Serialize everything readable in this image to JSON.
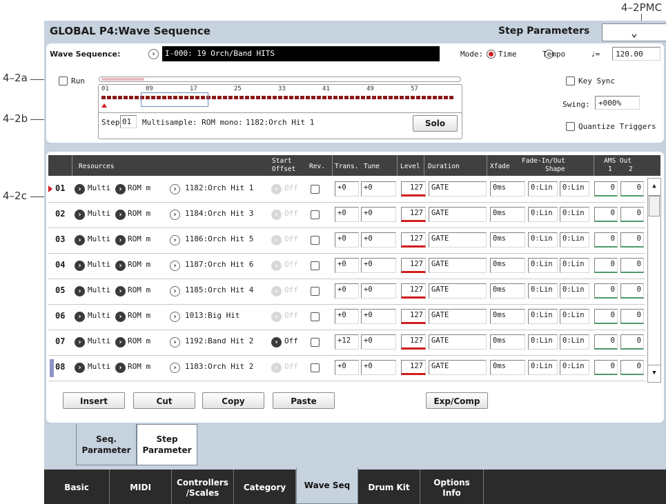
{
  "callouts": {
    "pmc": "4–2PMC",
    "a": "4–2a",
    "b": "4–2b",
    "c": "4–2c"
  },
  "page": {
    "title": "GLOBAL P4:Wave Sequence",
    "section": "Step Parameters",
    "menu_icon": "chevron-down-icon"
  },
  "wave_sequence": {
    "label": "Wave Sequence:",
    "value": "I-000: 19 Orch/Band HITS",
    "mode_label": "Mode:",
    "mode_options": [
      "Time",
      "Tempo"
    ],
    "mode_selected": "Time",
    "tempo_symbol": "♩=",
    "tempo_value": "120.00"
  },
  "overview": {
    "run_label": "Run",
    "ruler_ticks": [
      "01",
      "09",
      "17",
      "25",
      "33",
      "41",
      "49",
      "57"
    ],
    "step_label": "Step:",
    "step_value": "01",
    "multisample_label": "Multisample: ROM mono:",
    "multisample_value": "1182:Orch Hit 1",
    "solo_label": "Solo",
    "key_sync_label": "Key Sync",
    "swing_label": "Swing:",
    "swing_value": "+000%",
    "quantize_label": "Quantize Triggers",
    "step_count": 64
  },
  "table": {
    "headers": {
      "resources": "Resources",
      "start": "Start",
      "offset": "Offset",
      "rev": "Rev.",
      "trans": "Trans.",
      "tune": "Tune",
      "level": "Level",
      "duration": "Duration",
      "xfade": "Xfade",
      "fade": "Fade-In/Out",
      "shape": "Shape",
      "ams": "AMS Out",
      "ams1": "1",
      "ams2": "2"
    },
    "rows": [
      {
        "no": "01",
        "type": "Multi",
        "bank": "ROM m",
        "ms": "1182:Orch Hit 1",
        "offset": "Off",
        "offset_active": false,
        "trans": "+0",
        "tune": "+0",
        "level": "127",
        "duration": "GATE",
        "xfade": "0ms",
        "fin": "0:Lin",
        "fout": "0:Lin",
        "ams1": "0",
        "ams2": "0"
      },
      {
        "no": "02",
        "type": "Multi",
        "bank": "ROM m",
        "ms": "1184:Orch Hit 3",
        "offset": "Off",
        "offset_active": false,
        "trans": "+0",
        "tune": "+0",
        "level": "127",
        "duration": "GATE",
        "xfade": "0ms",
        "fin": "0:Lin",
        "fout": "0:Lin",
        "ams1": "0",
        "ams2": "0"
      },
      {
        "no": "03",
        "type": "Multi",
        "bank": "ROM m",
        "ms": "1186:Orch Hit 5",
        "offset": "Off",
        "offset_active": false,
        "trans": "+0",
        "tune": "+0",
        "level": "127",
        "duration": "GATE",
        "xfade": "0ms",
        "fin": "0:Lin",
        "fout": "0:Lin",
        "ams1": "0",
        "ams2": "0"
      },
      {
        "no": "04",
        "type": "Multi",
        "bank": "ROM m",
        "ms": "1187:Orch Hit 6",
        "offset": "Off",
        "offset_active": false,
        "trans": "+0",
        "tune": "+0",
        "level": "127",
        "duration": "GATE",
        "xfade": "0ms",
        "fin": "0:Lin",
        "fout": "0:Lin",
        "ams1": "0",
        "ams2": "0"
      },
      {
        "no": "05",
        "type": "Multi",
        "bank": "ROM m",
        "ms": "1185:Orch Hit 4",
        "offset": "Off",
        "offset_active": false,
        "trans": "+0",
        "tune": "+0",
        "level": "127",
        "duration": "GATE",
        "xfade": "0ms",
        "fin": "0:Lin",
        "fout": "0:Lin",
        "ams1": "0",
        "ams2": "0"
      },
      {
        "no": "06",
        "type": "Multi",
        "bank": "ROM m",
        "ms": "1013:Big Hit",
        "offset": "Off",
        "offset_active": false,
        "trans": "+0",
        "tune": "+0",
        "level": "127",
        "duration": "GATE",
        "xfade": "0ms",
        "fin": "0:Lin",
        "fout": "0:Lin",
        "ams1": "0",
        "ams2": "0"
      },
      {
        "no": "07",
        "type": "Multi",
        "bank": "ROM m",
        "ms": "1192:Band Hit 2",
        "offset": "Off",
        "offset_active": true,
        "trans": "+12",
        "tune": "+0",
        "level": "127",
        "duration": "GATE",
        "xfade": "0ms",
        "fin": "0:Lin",
        "fout": "0:Lin",
        "ams1": "0",
        "ams2": "0"
      },
      {
        "no": "08",
        "type": "Multi",
        "bank": "ROM m",
        "ms": "1183:Orch Hit 2",
        "offset": "Off",
        "offset_active": false,
        "trans": "+0",
        "tune": "+0",
        "level": "127",
        "duration": "GATE",
        "xfade": "0ms",
        "fin": "0:Lin",
        "fout": "0:Lin",
        "ams1": "0",
        "ams2": "0"
      }
    ]
  },
  "actions": {
    "insert": "Insert",
    "cut": "Cut",
    "copy": "Copy",
    "paste": "Paste",
    "expcomp": "Exp/Comp"
  },
  "subtabs": [
    {
      "l1": "Seq.",
      "l2": "Parameter"
    },
    {
      "l1": "Step",
      "l2": "Parameter"
    }
  ],
  "tabs": [
    {
      "l1": "Basic",
      "l2": ""
    },
    {
      "l1": "MIDI",
      "l2": ""
    },
    {
      "l1": "Controllers",
      "l2": "/Scales"
    },
    {
      "l1": "Category",
      "l2": ""
    },
    {
      "l1": "Wave Seq",
      "l2": ""
    },
    {
      "l1": "Drum Kit",
      "l2": ""
    },
    {
      "l1": "Options",
      "l2": "Info"
    }
  ],
  "colors": {
    "accent": "#d01c1c",
    "panel_bg": "#c6d2de",
    "tab_bg": "#2b2b2b",
    "step_marker": "#8b1a1a"
  }
}
